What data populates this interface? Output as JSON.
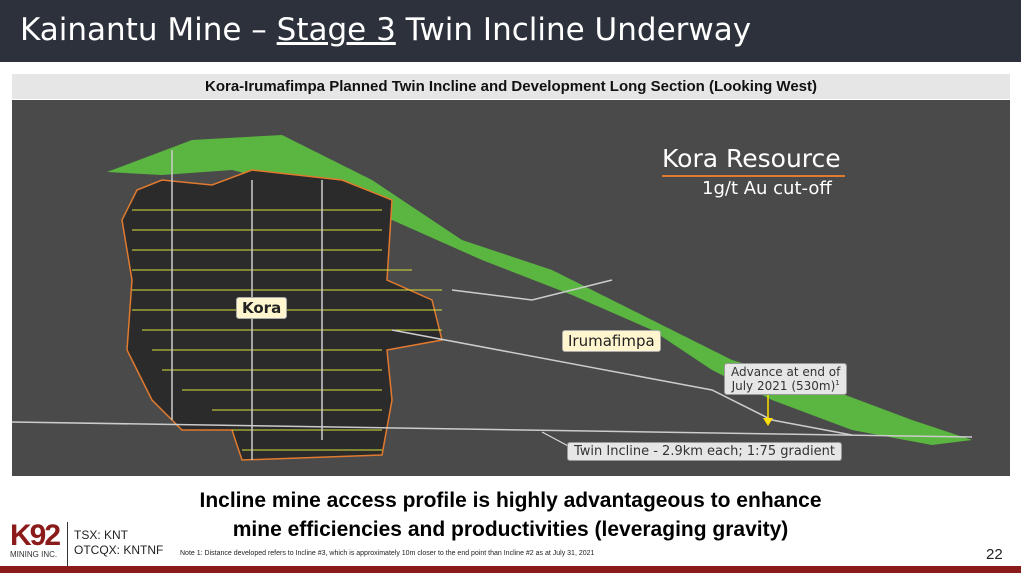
{
  "header": {
    "title_pre": "Kainantu Mine – ",
    "title_link": "Stage 3",
    "title_post": " Twin Incline Underway"
  },
  "figure": {
    "title": "Kora-Irumafimpa Planned Twin Incline and Development Long Section (Looking West)",
    "resource_title": "Kora Resource",
    "resource_cutoff": "1g/t Au cut-off",
    "kora_label": "Kora",
    "irumafimpa_label": "Irumafimpa",
    "advance_line1": "Advance at end of",
    "advance_line2": "July 2021 (530m)",
    "advance_sup": "1",
    "incline_label": "Twin Incline - 2.9km each; 1:75 gradient"
  },
  "main_text": {
    "line1": "Incline mine access profile is highly advantageous to enhance",
    "line2": "mine efficiencies and productivities (leveraging gravity)"
  },
  "footer": {
    "logo": "K92",
    "logo_sub": "MINING INC.",
    "tsx": "TSX: KNT",
    "otcqx": "OTCQX: KNTNF",
    "note": "Note 1: Distance developed refers to Incline #3, which is approximately 10m closer to the end point than Incline #2 as at July 31, 2021",
    "page": "22"
  },
  "colors": {
    "header": "#2c313b",
    "accent": "#8b1a1a",
    "resource": "#5cc23f"
  }
}
